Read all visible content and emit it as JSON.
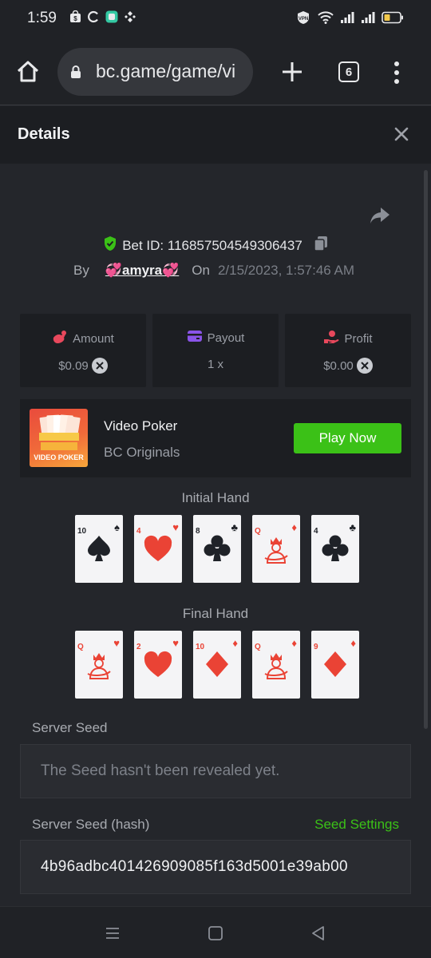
{
  "status_bar": {
    "time": "1:59",
    "battery_color": "#f2c94c"
  },
  "browser": {
    "url": "bc.game/game/vi",
    "tab_count": "6"
  },
  "details": {
    "title": "Details"
  },
  "bet": {
    "id_label": "Bet ID: 116857504549306437",
    "by_label": "By",
    "user": "💞amyra💞",
    "on_label": "On",
    "date": "2/15/2023, 1:57:46 AM"
  },
  "stats": {
    "amount": {
      "label": "Amount",
      "value": "$0.09"
    },
    "payout": {
      "label": "Payout",
      "value": "1 x"
    },
    "profit": {
      "label": "Profit",
      "value": "$0.00"
    }
  },
  "game": {
    "name": "Video Poker",
    "provider": "BC Originals",
    "thumb_text": "VIDEO POKER",
    "play_label": "Play Now",
    "accent": "#3bc117"
  },
  "initial_hand": {
    "label": "Initial Hand",
    "cards": [
      {
        "rank": "10",
        "suit": "spade"
      },
      {
        "rank": "4",
        "suit": "heart"
      },
      {
        "rank": "8",
        "suit": "club"
      },
      {
        "rank": "Q",
        "suit": "diamond"
      },
      {
        "rank": "4",
        "suit": "club"
      }
    ]
  },
  "final_hand": {
    "label": "Final Hand",
    "cards": [
      {
        "rank": "Q",
        "suit": "heart"
      },
      {
        "rank": "2",
        "suit": "heart"
      },
      {
        "rank": "10",
        "suit": "diamond"
      },
      {
        "rank": "Q",
        "suit": "diamond"
      },
      {
        "rank": "9",
        "suit": "diamond"
      }
    ]
  },
  "server_seed": {
    "label": "Server Seed",
    "placeholder": "The Seed hasn't been revealed yet."
  },
  "server_seed_hash": {
    "label": "Server Seed (hash)",
    "settings_link": "Seed Settings",
    "value": "4b96adbc401426909085f163d5001e39ab00"
  }
}
